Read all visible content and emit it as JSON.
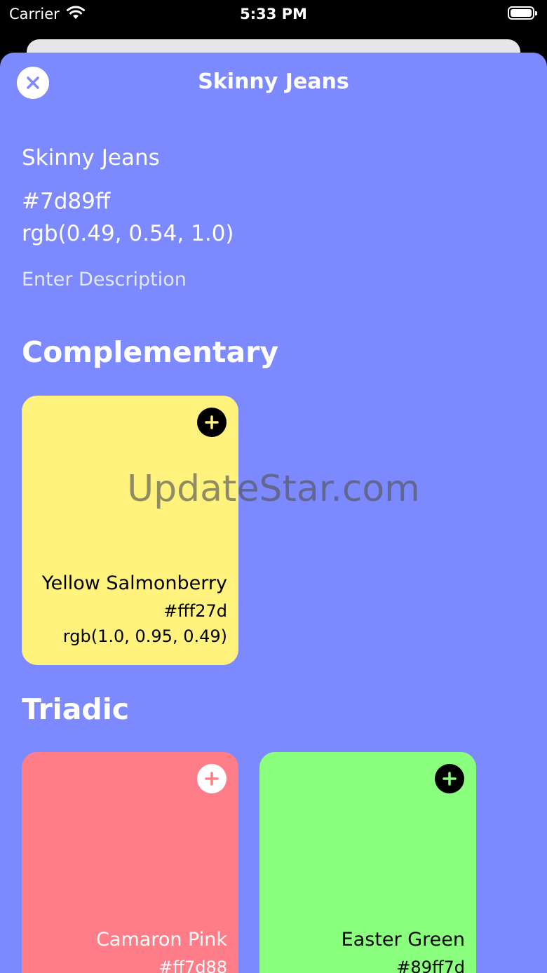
{
  "status_bar": {
    "carrier": "Carrier",
    "time": "5:33 PM"
  },
  "header": {
    "title": "Skinny Jeans",
    "close_icon": "close-icon"
  },
  "color": {
    "name": "Skinny Jeans",
    "hex": "#7d89ff",
    "rgb": "rgb(0.49, 0.54, 1.0)",
    "description_placeholder": "Enter Description"
  },
  "sections": {
    "complementary_title": "Complementary",
    "triadic_title": "Triadic"
  },
  "complementary": [
    {
      "name": "Yellow Salmonberry",
      "hex": "#fff27d",
      "rgb": "rgb(1.0, 0.95, 0.49)",
      "bg": "#fff27d",
      "text_color": "#000000",
      "add_color": "#000000"
    }
  ],
  "triadic": [
    {
      "name": "Camaron Pink",
      "hex": "#ff7d88",
      "bg": "#ff7d88",
      "text_color": "#ffffff",
      "add_color": "#ffffff"
    },
    {
      "name": "Easter Green",
      "hex": "#89ff7d",
      "bg": "#89ff7d",
      "text_color": "#000000",
      "add_color": "#000000"
    }
  ],
  "watermark": "UpdateStar.com",
  "theme": {
    "sheet_bg": "#7d89ff"
  }
}
